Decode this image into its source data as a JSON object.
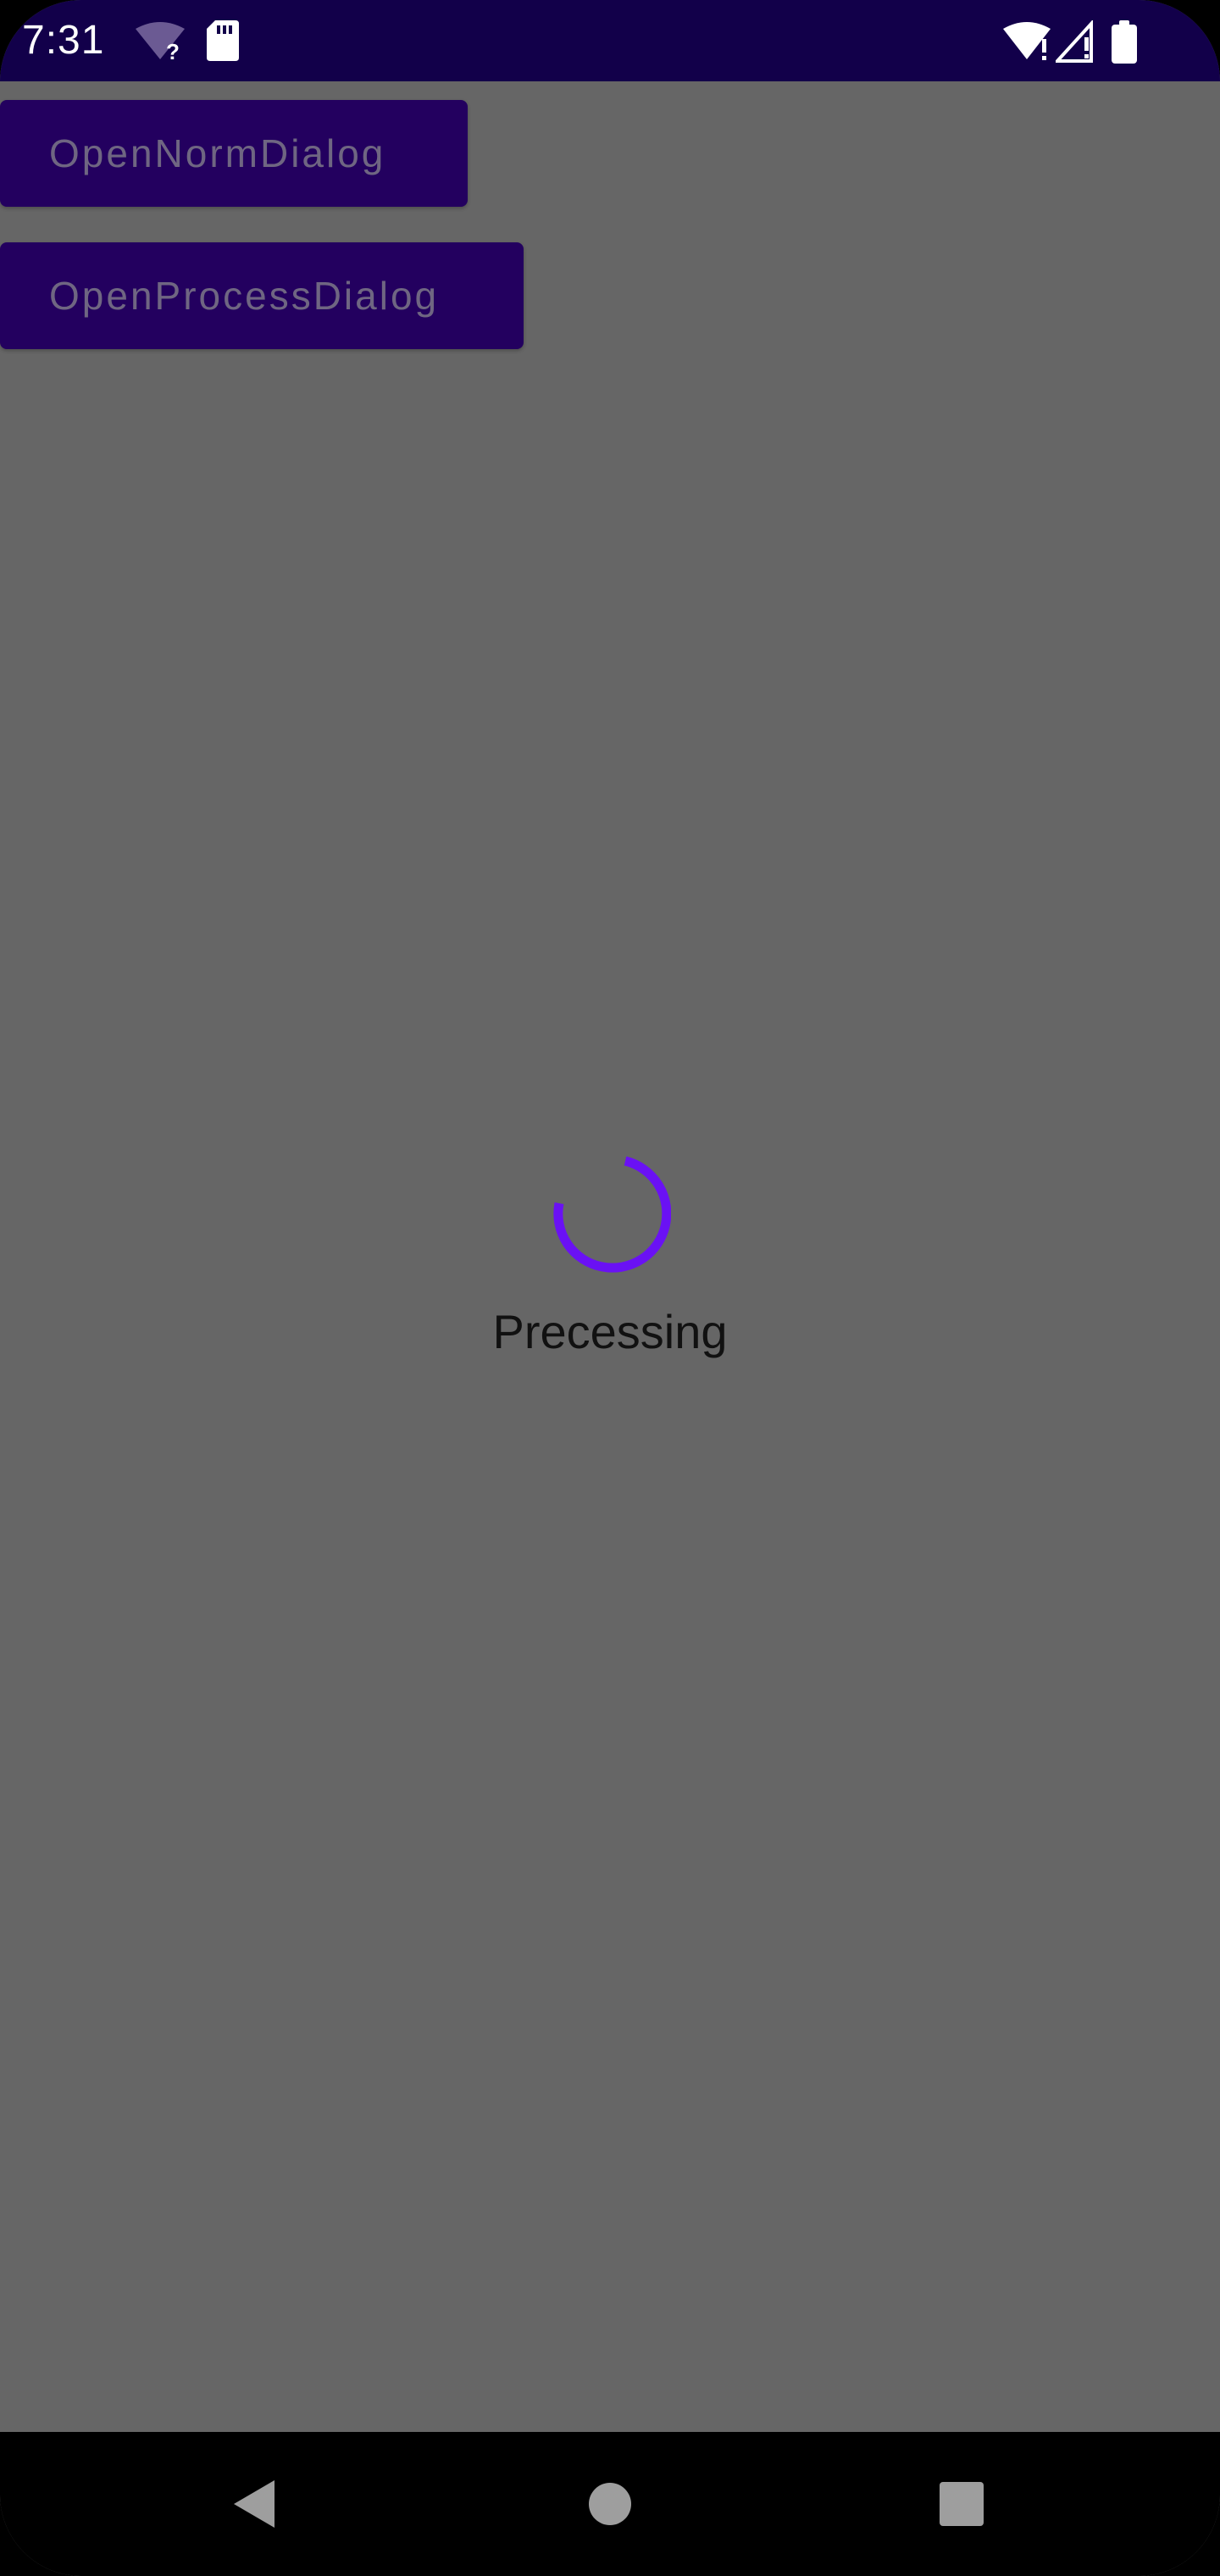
{
  "status_bar": {
    "time": "7:31",
    "left_icons": [
      "wifi-unknown-icon",
      "sd-card-icon"
    ],
    "right_icons": [
      "wifi-alert-icon",
      "signal-alert-icon",
      "battery-icon"
    ],
    "background": "#12004a"
  },
  "buttons": {
    "open_norm_dialog": "OpenNormDialog",
    "open_process_dialog": "OpenProcessDialog",
    "background": "#23005f",
    "text_color": "#6f6682"
  },
  "progress_dialog": {
    "message": "Precessing",
    "spinner_color": "#6a11f4",
    "spinner_icon": "circular-progress-icon"
  },
  "scrim_color": "#666666",
  "nav_bar": {
    "icons": [
      "back-icon",
      "home-icon",
      "recents-icon"
    ]
  }
}
